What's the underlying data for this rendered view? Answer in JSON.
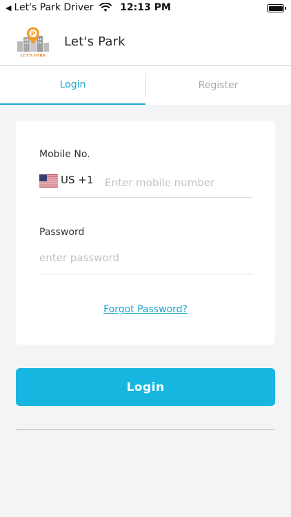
{
  "status_bar": {
    "back_label": "Let's Park Driver",
    "time": "12:13 PM"
  },
  "header": {
    "title": "Let's Park",
    "logo_text": "LET'S PARK",
    "logo_letter": "P"
  },
  "tabs": [
    {
      "label": "Login",
      "active": true
    },
    {
      "label": "Register",
      "active": false
    }
  ],
  "form": {
    "mobile_label": "Mobile No.",
    "country_code": "US +1",
    "mobile_value": "",
    "mobile_placeholder": "Enter mobile number",
    "password_label": "Password",
    "password_value": "",
    "password_placeholder": "enter password",
    "forgot_label": "Forgot Password?"
  },
  "login_button_label": "Login",
  "colors": {
    "accent": "#1aa6cf",
    "button": "#16b6e0",
    "background": "#f3f4f6",
    "logo_orange": "#f39a2b"
  },
  "icons": {
    "back": "back-arrow-icon",
    "wifi": "wifi-icon",
    "battery": "battery-icon",
    "flag": "us-flag-icon"
  }
}
